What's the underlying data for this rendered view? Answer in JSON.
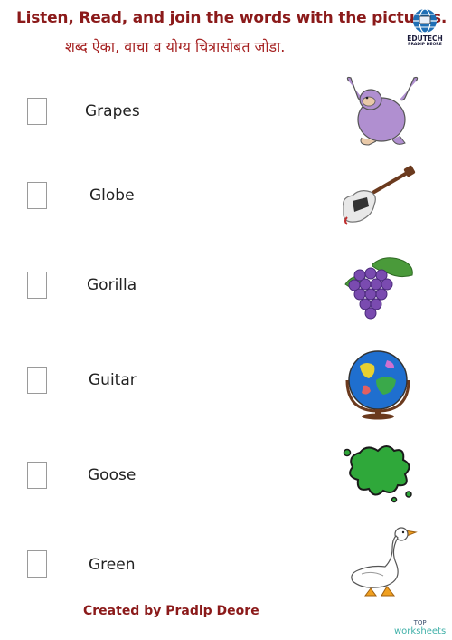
{
  "header": {
    "title": "Listen, Read, and join the words with the pictures.",
    "subtitle": "शब्द ऐका, वाचा व योग्य चित्रासोबत जोडा.",
    "logo": {
      "line1": "EDUTECH",
      "line2": "PRADIP DEORE",
      "icon": "globe-computer-icon"
    }
  },
  "words": [
    "Grapes",
    "Globe",
    "Gorilla",
    "Guitar",
    "Goose",
    "Green"
  ],
  "pictures": [
    "gorilla",
    "guitar",
    "grapes",
    "globe",
    "green-splat",
    "goose"
  ],
  "footer": {
    "credit": "Created by Pradip Deore",
    "brand_top": "TOP",
    "brand_bottom": "worksheets"
  },
  "colors": {
    "title": "#8b1a1a",
    "brand_teal": "#3fb0a8"
  }
}
